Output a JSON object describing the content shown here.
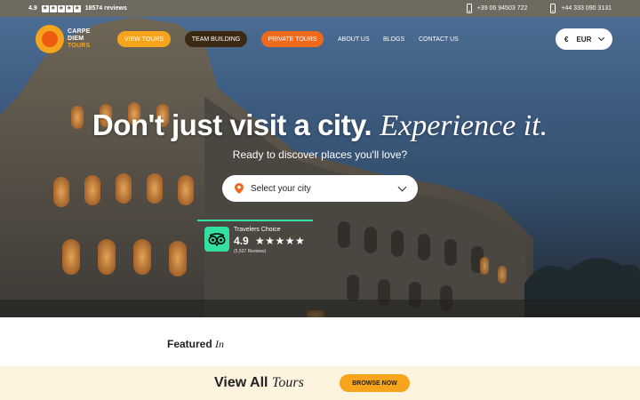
{
  "topbar": {
    "rating": "4.9",
    "stars": [
      "★",
      "★",
      "★",
      "★",
      "★"
    ],
    "reviews": "18574 reviews",
    "phones": [
      "+39 06 94503 722",
      "+44 333 090 3131"
    ]
  },
  "brand": {
    "line1": "Carpe",
    "line2": "Diem",
    "line3": "Tours",
    "colors": {
      "orange": "#f7a41d",
      "deep_orange": "#ef5a12"
    }
  },
  "nav": {
    "view_tours": "View Tours",
    "team_building": "Team Building",
    "private_tours": "Private Tours",
    "about": "About Us",
    "blogs": "Blogs",
    "contact": "Contact Us"
  },
  "currency": {
    "symbol": "€",
    "code": "EUR"
  },
  "hero": {
    "headline_bold": "Don't just visit a city.",
    "headline_italic": "Experience it.",
    "subheadline": "Ready to discover places you'll love?",
    "city_placeholder": "Select your city"
  },
  "travelers_choice": {
    "title": "Travelers Choice",
    "rating": "4.9",
    "stars": "★★★★★",
    "reviews": "(5,537 Reviews)"
  },
  "featured": {
    "bold": "Featured",
    "italic": "In"
  },
  "cta": {
    "bold": "View All",
    "italic": "Tours",
    "button": "Browse Now"
  },
  "colors": {
    "pill_view_tours": "#f7a41d",
    "pill_team_building": "#3a2a14",
    "pill_private_tours": "#ef6a1d",
    "tripadvisor_green": "#34e0a1",
    "cta_background": "#fdf3df"
  }
}
